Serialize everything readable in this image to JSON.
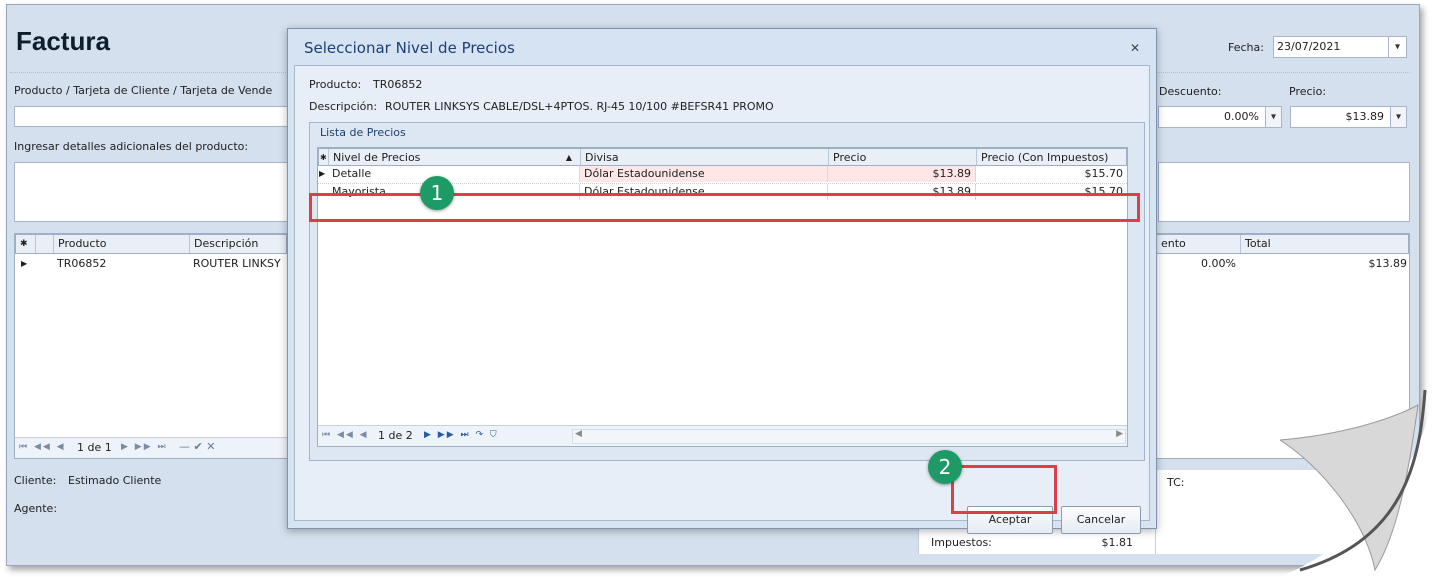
{
  "app": {
    "title": "Factura",
    "fecha_label": "Fecha:",
    "fecha_value": "23/07/2021",
    "product_field_label": "Producto / Tarjeta de Cliente / Tarjeta de Vende",
    "details_label": "Ingresar detalles adicionales del producto:",
    "descuento_label": "Descuento:",
    "descuento_value": "0.00%",
    "precio_label": "Precio:",
    "precio_value": "$13.89"
  },
  "items_grid": {
    "headers": [
      "Producto",
      "Descripción",
      "ento",
      "Total"
    ],
    "rows": [
      {
        "producto": "TR06852",
        "descripcion": "ROUTER LINKSY",
        "descuento": "0.00%",
        "total": "$13.89"
      }
    ],
    "pager": "1 de 1"
  },
  "footer": {
    "cliente_label": "Cliente:",
    "cliente_value": "Estimado Cliente",
    "agente_label": "Agente:",
    "tc_label": "TC:",
    "impuestos_label": "Impuestos:",
    "impuestos_value": "$1.81"
  },
  "dialog": {
    "title": "Seleccionar Nivel de Precios",
    "close_icon": "close-icon",
    "producto_label": "Producto:",
    "producto_value": "TR06852",
    "descripcion_label": "Descripción:",
    "descripcion_value": "ROUTER LINKSYS CABLE/DSL+4PTOS. RJ-45 10/100 #BEFSR41 PROMO",
    "group_title": "Lista de Precios",
    "columns": [
      "Nivel de Precios",
      "Divisa",
      "Precio",
      "Precio (Con Impuestos)"
    ],
    "rows": [
      {
        "nivel": "Detalle",
        "divisa": "Dólar Estadounidense",
        "precio": "$13.89",
        "precio_imp": "$15.70"
      },
      {
        "nivel": "Mayorista",
        "divisa": "Dólar Estadounidense",
        "precio": "$13.89",
        "precio_imp": "$15.70"
      }
    ],
    "pager": "1 de 2",
    "accept_label": "Aceptar",
    "cancel_label": "Cancelar"
  },
  "callouts": [
    "1",
    "2"
  ],
  "colors": {
    "callout": "#1e9a66",
    "highlight": "#d9414a",
    "background": "#d4e0ee"
  }
}
